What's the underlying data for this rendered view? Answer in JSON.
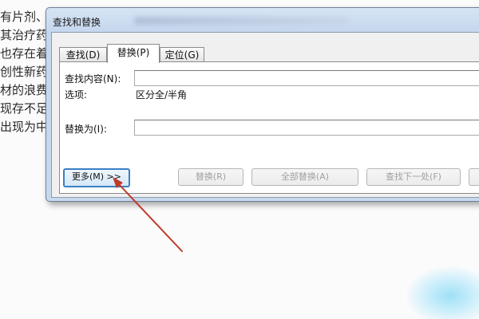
{
  "document": {
    "lines": [
      "有片剂、",
      "其治疗药",
      "也存在着",
      "创性新药",
      "材的浪费",
      "现存不足",
      "出现为中"
    ]
  },
  "dialog": {
    "title": "查找和替换",
    "tabs": [
      {
        "label": "查找(D)",
        "active": false
      },
      {
        "label": "替换(P)",
        "active": true
      },
      {
        "label": "定位(G)",
        "active": false
      }
    ],
    "find_label": "查找内容(N):",
    "find_value": "",
    "options_label": "选项:",
    "options_value": "区分全/半角",
    "replace_label": "替换为(I):",
    "replace_value": "",
    "buttons": {
      "more": "更多(M) >>",
      "replace": "替换(R)",
      "replace_all": "全部替换(A)",
      "find_next": "查找下一处(F)"
    }
  },
  "annotation": {
    "arrow_color": "#c0392b"
  },
  "colors": {
    "accent": "#3b7fc4",
    "dialog_frame": "#c5d7ee"
  }
}
